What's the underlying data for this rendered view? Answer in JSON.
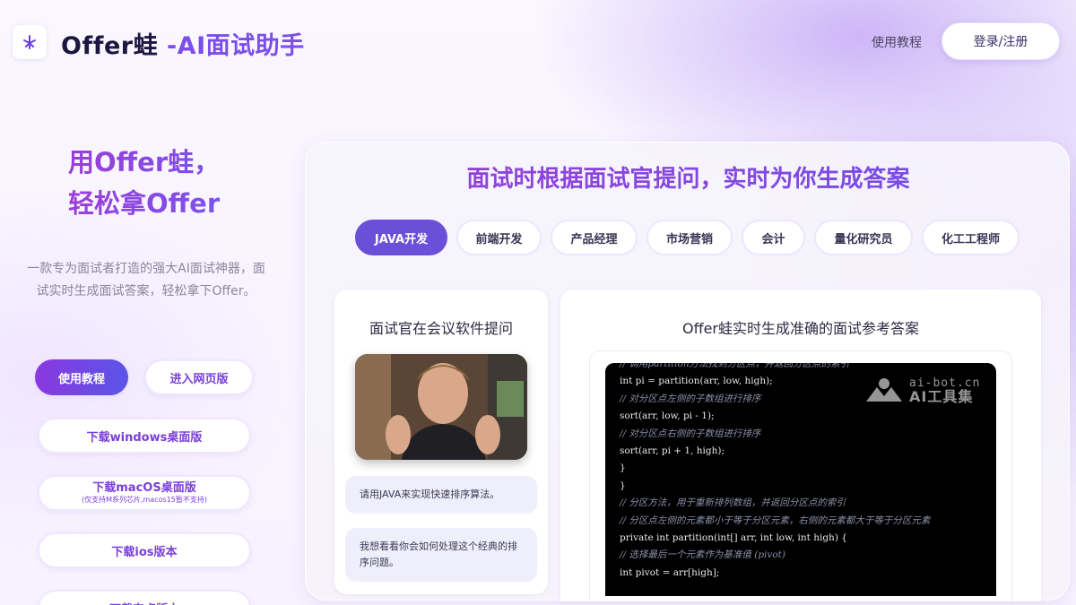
{
  "header": {
    "brand_name": "Offer蛙",
    "brand_suffix": " -AI面试助手",
    "tutorial_link": "使用教程",
    "login_button": "登录/注册"
  },
  "hero": {
    "title_line1": "用Offer蛙，",
    "title_line2": "轻松拿Offer",
    "description": "一款专为面试者打造的强大AI面试神器，面试实时生成面试答案，轻松拿下Offer。"
  },
  "left_buttons": {
    "tutorial": "使用教程",
    "web": "进入网页版",
    "windows": "下载windows桌面版",
    "macos": "下载macOS桌面版",
    "macos_note": "(仅支持M系列芯片,macos15暂不支持)",
    "ios": "下载ios版本",
    "more": "下载安卓版本"
  },
  "panel": {
    "title": "面试时根据面试官提问，实时为你生成答案",
    "tabs": [
      "JAVA开发",
      "前端开发",
      "产品经理",
      "市场营销",
      "会计",
      "量化研究员",
      "化工工程师"
    ],
    "active_tab": 0,
    "left_card_title": "面试官在会议软件提问",
    "bubble1": "请用JAVA来实现快速排序算法。",
    "bubble2": "我想看看你会如何处理这个经典的排序问题。",
    "right_card_title": "Offer蛙实时生成准确的面试参考答案",
    "code_lines": [
      {
        "t": "// 调用partition方法找到分区点，并返回分区点的索引",
        "c": "cm"
      },
      {
        "t": "int pi = partition(arr, low, high);",
        "c": ""
      },
      {
        "t": "// 对分区点左侧的子数组进行排序",
        "c": "cm"
      },
      {
        "t": "sort(arr, low, pi - 1);",
        "c": ""
      },
      {
        "t": "// 对分区点右侧的子数组进行排序",
        "c": "cm"
      },
      {
        "t": "sort(arr, pi + 1, high);",
        "c": ""
      },
      {
        "t": "}",
        "c": ""
      },
      {
        "t": "}",
        "c": ""
      },
      {
        "t": "// 分区方法，用于重新排列数组，并返回分区点的索引",
        "c": "cm"
      },
      {
        "t": "// 分区点左侧的元素都小于等于分区元素，右侧的元素都大于等于分区元素",
        "c": "cm"
      },
      {
        "t": "private int partition(int[] arr, int low, int high) {",
        "c": ""
      },
      {
        "t": "// 选择最后一个元素作为基准值 (pivot)",
        "c": "cm"
      },
      {
        "t": "int pivot = arr[high];",
        "c": ""
      }
    ]
  },
  "watermark": {
    "line1": "ai-bot.cn",
    "line2": "AI工具集"
  }
}
